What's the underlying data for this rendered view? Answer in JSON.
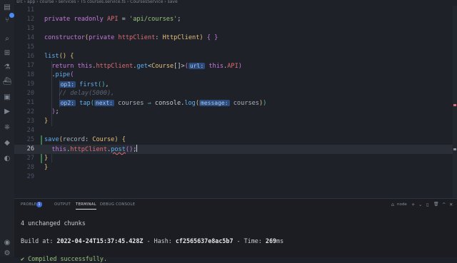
{
  "breadcrumb": "src › app › course › services › TS courses.service.ts › CoursesService › save",
  "editor": {
    "current_line": "26",
    "lines": [
      {
        "num": "11"
      },
      {
        "num": "12",
        "tokens": [
          {
            "cls": "k",
            "text": "private readonly "
          },
          {
            "cls": "v",
            "text": "API"
          },
          {
            "cls": "p",
            "text": " = "
          },
          {
            "cls": "s",
            "text": "'api/courses'"
          },
          {
            "cls": "p",
            "text": ";"
          }
        ]
      },
      {
        "num": "13"
      },
      {
        "num": "14",
        "tokens": [
          {
            "cls": "k",
            "text": "constructor"
          },
          {
            "cls": "br1",
            "text": "("
          },
          {
            "cls": "k",
            "text": "private "
          },
          {
            "cls": "v",
            "text": "httpClient"
          },
          {
            "cls": "p",
            "text": ": "
          },
          {
            "cls": "t",
            "text": "HttpClient"
          },
          {
            "cls": "br1",
            "text": ")"
          },
          {
            "cls": "p",
            "text": " "
          },
          {
            "cls": "br2",
            "text": "{"
          },
          {
            "cls": "p",
            "text": " "
          },
          {
            "cls": "br2",
            "text": "}"
          }
        ]
      },
      {
        "num": "15"
      },
      {
        "num": "16",
        "tokens": [
          {
            "cls": "f",
            "text": "list"
          },
          {
            "cls": "br1",
            "text": "()"
          },
          {
            "cls": "p",
            "text": " "
          },
          {
            "cls": "br1",
            "text": "{"
          }
        ]
      },
      {
        "num": "17",
        "tokens": [
          {
            "cls": "k",
            "text": "  return "
          },
          {
            "cls": "k",
            "text": "this"
          },
          {
            "cls": "p",
            "text": "."
          },
          {
            "cls": "v",
            "text": "httpClient"
          },
          {
            "cls": "p",
            "text": "."
          },
          {
            "cls": "f",
            "text": "get"
          },
          {
            "cls": "p",
            "text": "<"
          },
          {
            "cls": "t",
            "text": "Course"
          },
          {
            "cls": "p",
            "text": "[]>"
          },
          {
            "cls": "br2",
            "text": "("
          },
          {
            "cls": "hint",
            "text": "url:"
          },
          {
            "cls": "p",
            "text": " "
          },
          {
            "cls": "k",
            "text": "this"
          },
          {
            "cls": "p",
            "text": "."
          },
          {
            "cls": "v",
            "text": "API"
          },
          {
            "cls": "br2",
            "text": ")"
          }
        ]
      },
      {
        "num": "18",
        "tokens": [
          {
            "cls": "p",
            "text": "  ."
          },
          {
            "cls": "f",
            "text": "pipe"
          },
          {
            "cls": "br2",
            "text": "("
          }
        ]
      },
      {
        "num": "19",
        "tokens": [
          {
            "cls": "p",
            "text": "    "
          },
          {
            "cls": "hint",
            "text": "op1:"
          },
          {
            "cls": "p",
            "text": " "
          },
          {
            "cls": "f",
            "text": "first"
          },
          {
            "cls": "arrow",
            "text": "()"
          },
          {
            "cls": "p",
            "text": ","
          }
        ]
      },
      {
        "num": "20",
        "tokens": [
          {
            "cls": "c",
            "text": "    // delay(5000),"
          }
        ]
      },
      {
        "num": "21",
        "tokens": [
          {
            "cls": "p",
            "text": "    "
          },
          {
            "cls": "hint",
            "text": "op2:"
          },
          {
            "cls": "p",
            "text": " "
          },
          {
            "cls": "f",
            "text": "tap"
          },
          {
            "cls": "arrow",
            "text": "("
          },
          {
            "cls": "hint",
            "text": "next:"
          },
          {
            "cls": "p",
            "text": " "
          },
          {
            "cls": "pm",
            "text": "courses"
          },
          {
            "cls": "arrow",
            "text": " ⇒ "
          },
          {
            "cls": "p",
            "text": "console."
          },
          {
            "cls": "f",
            "text": "log"
          },
          {
            "cls": "br1",
            "text": "("
          },
          {
            "cls": "hint",
            "text": "message:"
          },
          {
            "cls": "p",
            "text": " "
          },
          {
            "cls": "pm",
            "text": "courses"
          },
          {
            "cls": "br1",
            "text": ")"
          },
          {
            "cls": "arrow",
            "text": ")"
          }
        ]
      },
      {
        "num": "22",
        "tokens": [
          {
            "cls": "br2",
            "text": "  )"
          },
          {
            "cls": "p",
            "text": ";"
          }
        ]
      },
      {
        "num": "23",
        "tokens": [
          {
            "cls": "br1",
            "text": "}"
          }
        ]
      },
      {
        "num": "24"
      },
      {
        "num": "25",
        "tokens": [
          {
            "cls": "f",
            "text": "save"
          },
          {
            "cls": "br1",
            "text": "("
          },
          {
            "cls": "pm",
            "text": "record"
          },
          {
            "cls": "p",
            "text": ": "
          },
          {
            "cls": "t",
            "text": "Course"
          },
          {
            "cls": "br1",
            "text": ")"
          },
          {
            "cls": "p",
            "text": " "
          },
          {
            "cls": "br1",
            "text": "{"
          }
        ]
      },
      {
        "num": "26",
        "tokens": [
          {
            "cls": "p",
            "text": "  "
          },
          {
            "cls": "k",
            "text": "this"
          },
          {
            "cls": "p",
            "text": "."
          },
          {
            "cls": "v",
            "text": "httpClient"
          },
          {
            "cls": "p",
            "text": "."
          },
          {
            "cls": "f squig",
            "text": "post"
          },
          {
            "cls": "br2",
            "text": "()"
          },
          {
            "cls": "p",
            "text": ";"
          }
        ]
      },
      {
        "num": "27",
        "tokens": [
          {
            "cls": "br1",
            "text": "}"
          }
        ]
      },
      {
        "num": "28",
        "tokens": [
          {
            "cls": "br1",
            "text": "}"
          }
        ]
      },
      {
        "num": "29"
      }
    ]
  },
  "panel": {
    "tabs": [
      "PROBLEMS",
      "OUTPUT",
      "TERMINAL",
      "DEBUG CONSOLE"
    ],
    "active_tab": "TERMINAL",
    "problems_count": "1",
    "terminal_name": "node",
    "controls": [
      "+",
      "⌄",
      "▯",
      "🗑",
      "^",
      "✕"
    ],
    "terminal_lines": [
      {
        "tokens": [
          {
            "cls": "",
            "text": "4 unchanged chunks"
          }
        ]
      },
      {
        "tokens": [
          {
            "cls": "",
            "text": ""
          }
        ]
      },
      {
        "tokens": [
          {
            "cls": "",
            "text": "Build at: "
          },
          {
            "cls": "bold",
            "text": "2022-04-24T15:37:45.428Z"
          },
          {
            "cls": "",
            "text": " - Hash: "
          },
          {
            "cls": "bold",
            "text": "cf2565637e8ac5b7"
          },
          {
            "cls": "",
            "text": " - Time: "
          },
          {
            "cls": "bold",
            "text": "269"
          },
          {
            "cls": "",
            "text": "ms"
          }
        ]
      },
      {
        "tokens": [
          {
            "cls": "",
            "text": ""
          }
        ]
      },
      {
        "tokens": [
          {
            "cls": "ok",
            "text": "✔ Compiled successfully."
          }
        ]
      }
    ]
  },
  "activity_icons": [
    "explorer-icon",
    "source-control-icon",
    "search-icon",
    "extensions-icon",
    "testing-icon",
    "docker-icon",
    "remote-explorer-icon",
    "run-debug-icon",
    "kubernetes-icon",
    "git-graph-icon",
    "edge-icon",
    "account-icon",
    "settings-icon"
  ]
}
